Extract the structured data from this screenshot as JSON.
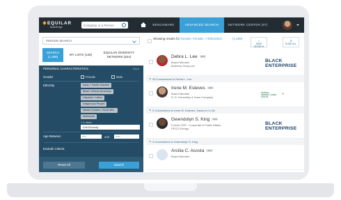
{
  "topbar": {
    "logo_line1": "EQUILAR",
    "logo_line2": "BoardEdge",
    "search_placeholder": "Company or a Person",
    "nav": [
      "BENCHMARK",
      "ADVANCED SEARCH",
      "NETWORK CENTER (97)"
    ],
    "active_nav": "ADVANCED SEARCH"
  },
  "left": {
    "person_search_label": "PERSON SEARCH",
    "tabs": {
      "search": "SEARCH",
      "search_count": "(1,289)",
      "my_lists": "MY LISTS (128)",
      "equilar_line1": "EQUILAR DIVERSITY",
      "equilar_line2": "NETWORK (624)"
    },
    "characteristics_header": "PERSONAL CHARACTERISTICS",
    "clear_label": "Clear",
    "gender_label": "Gender",
    "gender_options": [
      "Female",
      "Male"
    ],
    "ethnicity_label": "Ethnicity",
    "ethnicity_chips": [
      "Asian / Pacific Islander",
      "Black / African American",
      "Hispanic / Latino",
      "Indigenous People",
      "Middle Eastern / North Afri...",
      "Multiracial"
    ],
    "more_text": "+ 1 more",
    "edit_ethnicity": "Edit Ethnicity",
    "age_label": "Age Between",
    "age_min_placeholder": "min",
    "age_and": "and",
    "age_max_placeholder": "max",
    "exclude_label": "Exclude Criteria",
    "reset_label": "Reset All",
    "search_label": "Search"
  },
  "results": {
    "header_prefix": "Showing results for",
    "header_highlight": "Gender: Female, 7 Ethnicities",
    "header_count": "(1,289)",
    "save_search": "SAVE SEARCH",
    "select_all": "SLIDE ALL",
    "people": [
      {
        "name": "Debra L. Lee",
        "badge": "2nd",
        "title": "Board Member",
        "company": "Burberry Group plc",
        "org": "BLACK ENTERPRISE"
      },
      {
        "name": "Irene M. Esteves",
        "badge": "2nd",
        "title": "Board Member",
        "company": "R. R. Donnelley & Sons Company",
        "org": "NATIONAL HISPANIC / LATINO CAUCUS"
      },
      {
        "name": "Gwendolyn S. King",
        "badge": "2nd",
        "title": "Former SVP - Corporate & Public Affairs",
        "company": "PECO Energy",
        "org": "BLACK ENTERPRISE"
      },
      {
        "name": "Arcilia C. Acosta",
        "badge": "2nd",
        "title": "Board Member",
        "company": "",
        "org": ""
      }
    ],
    "connections": [
      "25 Connections to Debra L. Lee",
      "9 Connections to Irene M. Esteves, Saved in 1 List",
      "4 Connections to Gwendolyn S. King"
    ]
  },
  "colors": {
    "topbar": "#232c33",
    "accent": "#3aa0d8",
    "panel": "#244c66",
    "org_logo": "#1b3f66"
  }
}
